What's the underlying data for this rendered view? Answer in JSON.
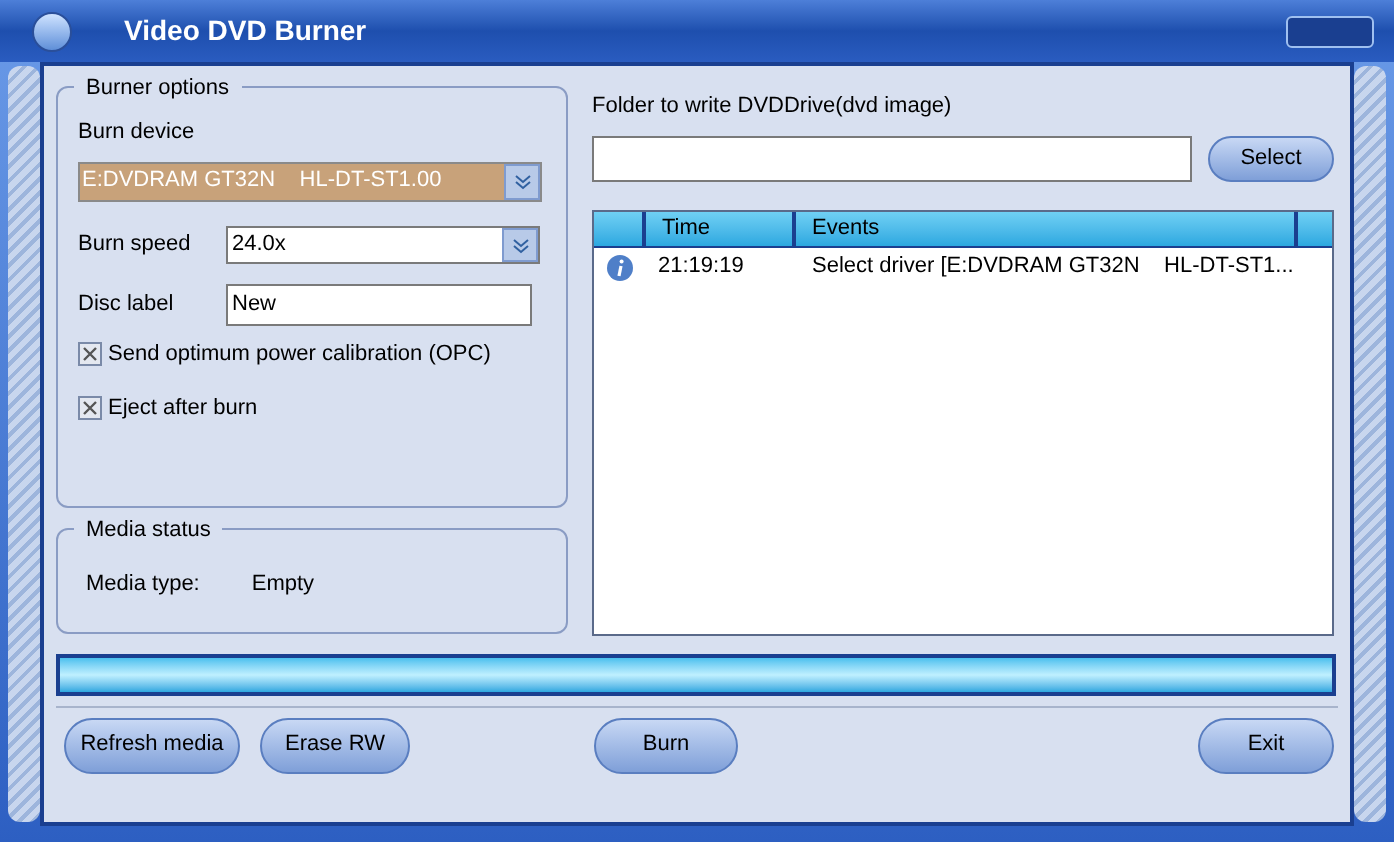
{
  "window": {
    "title": "Video DVD Burner"
  },
  "burner_options": {
    "title": "Burner options",
    "burn_device_label": "Burn device",
    "burn_device": "E:DVDRAM GT32N    HL-DT-ST1.00",
    "burn_speed_label": "Burn speed",
    "burn_speed": "24.0x",
    "disc_label_label": "Disc label",
    "disc_label": "New",
    "checkboxes": [
      {
        "label": "Send optimum power calibration (OPC)",
        "checked": true
      },
      {
        "label": "Eject after burn",
        "checked": true
      }
    ]
  },
  "media_status": {
    "title": "Media status",
    "label": "Media type:",
    "value": "Empty"
  },
  "folder": {
    "label": "Folder to write DVDDrive(dvd image)",
    "button": "Select"
  },
  "log": {
    "columns": [
      "Time",
      "Events"
    ],
    "rows": [
      {
        "kind": "info",
        "time": "21:19:19",
        "event": "Select driver [E:DVDRAM GT32N    HL-DT-ST1..."
      }
    ]
  },
  "progress": {
    "level": 1
  },
  "buttons": [
    "Refresh media",
    "Erase RW",
    "Burn",
    "Exit"
  ]
}
